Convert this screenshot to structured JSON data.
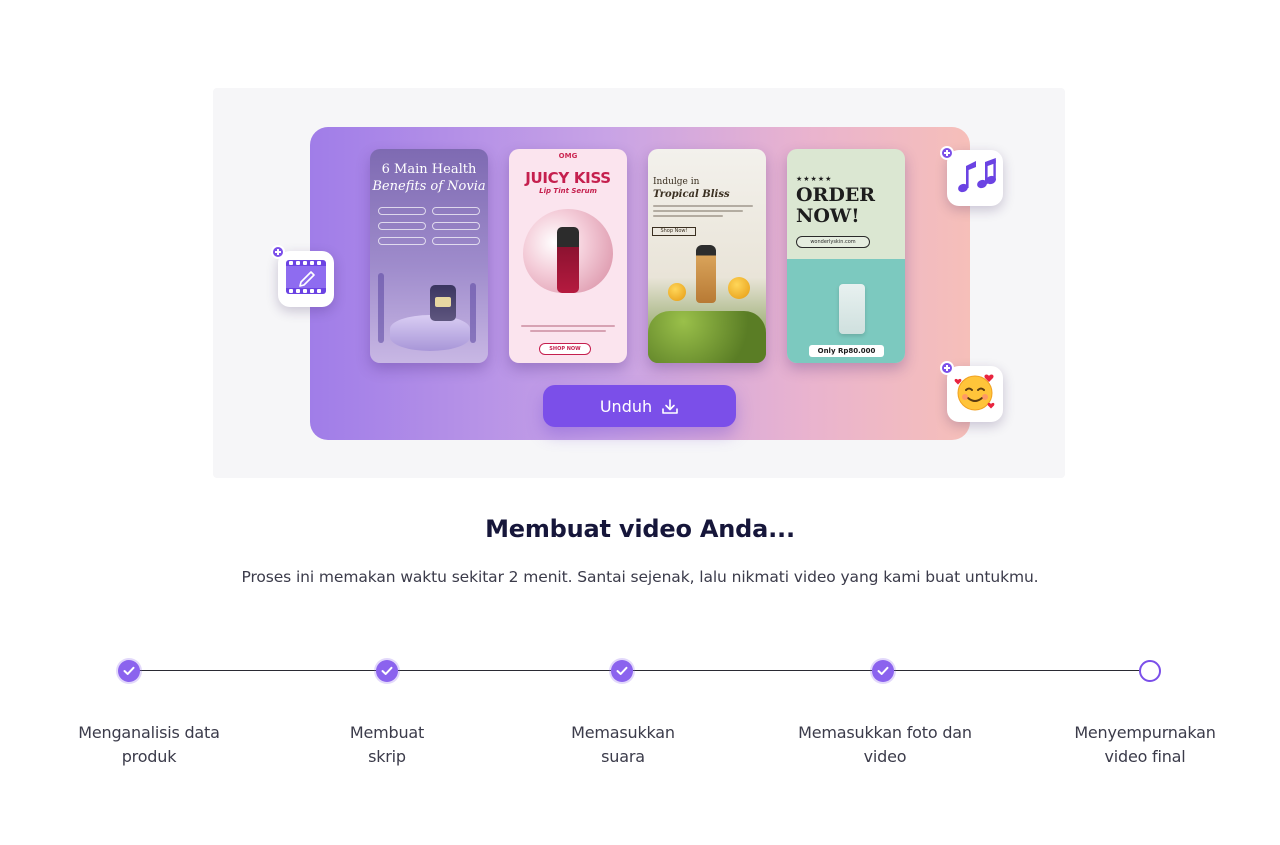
{
  "preview": {
    "thumbnails": [
      {
        "title_line1": "6 Main Health",
        "title_line2": "Benefits of Novia"
      },
      {
        "brand": "OMG",
        "title": "JUICY KISS",
        "subtitle": "Lip Tint Serum",
        "button": "SHOP NOW"
      },
      {
        "title_line1": "Indulge in",
        "title_line2": "Tropical Bliss",
        "button": "Shop Now!"
      },
      {
        "stars": "★★★★★",
        "title_line1": "ORDER",
        "title_line2": "NOW!",
        "url": "wonderlyskin.com",
        "price": "Only Rp80.000"
      }
    ],
    "download_button": "Unduh",
    "tiles": {
      "video_icon": "video-edit-icon",
      "music_icon": "music-notes-icon",
      "emoji_icon": "smiling-face-with-hearts-icon"
    }
  },
  "heading": {
    "title": "Membuat video Anda...",
    "subtitle": "Proses ini memakan waktu sekitar 2 menit. Santai sejenak, lalu nikmati video yang kami buat untukmu."
  },
  "steps": [
    {
      "line1": "Menganalisis data",
      "line2": "produk",
      "status": "done"
    },
    {
      "line1": "Membuat",
      "line2": "skrip",
      "status": "done"
    },
    {
      "line1": "Memasukkan",
      "line2": "suara",
      "status": "done"
    },
    {
      "line1": "Memasukkan foto dan",
      "line2": "video",
      "status": "done"
    },
    {
      "line1": "Menyempurnakan",
      "line2": "video final",
      "status": "pending"
    }
  ],
  "colors": {
    "accent": "#7b4fe9",
    "step_done": "#8b63ee",
    "title": "#16163a",
    "body_text": "#3b3b4a"
  }
}
